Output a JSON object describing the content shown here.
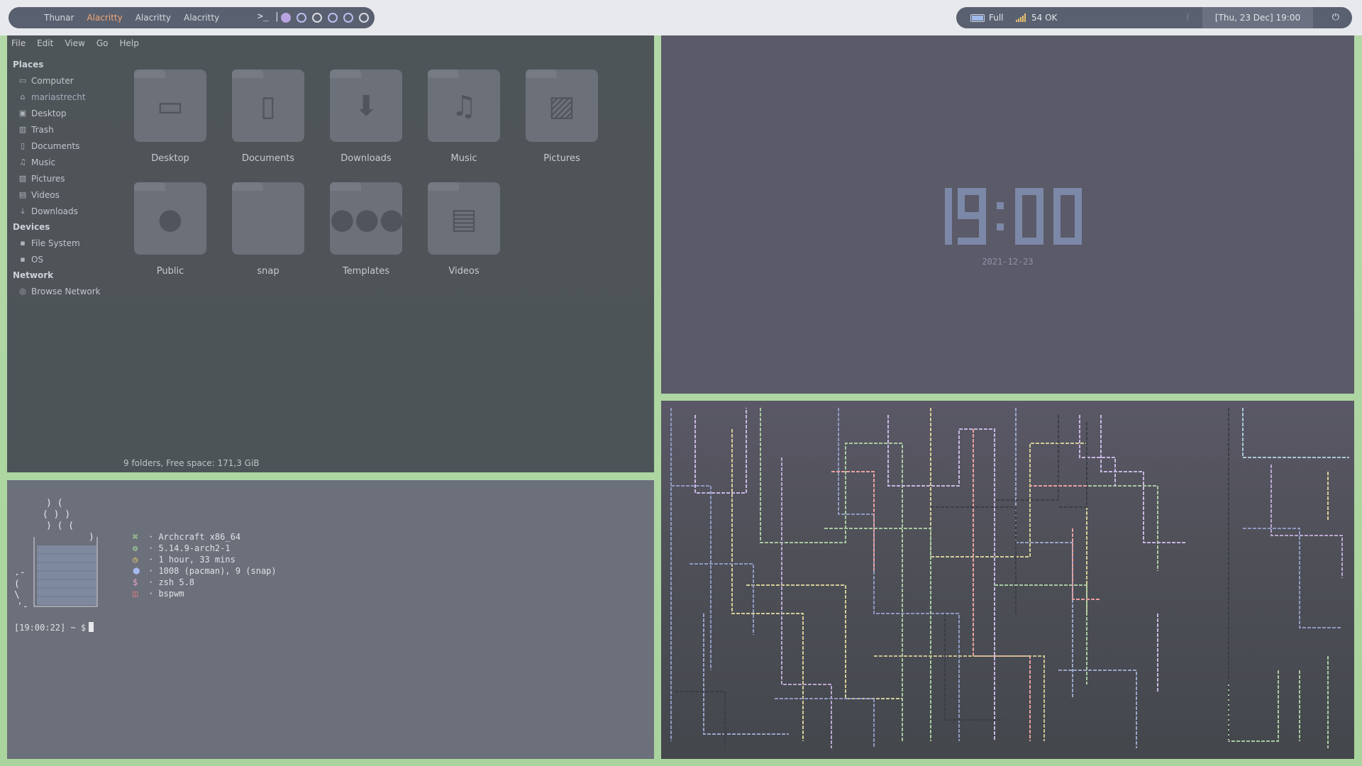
{
  "topbar": {
    "windows": [
      "Thunar",
      "Alacritty",
      "Alacritty",
      "Alacritty"
    ],
    "active_window_index": 1,
    "terminal_glyph": ">_ |",
    "workspaces": [
      "1",
      "2",
      "3",
      "4",
      "5",
      "6"
    ],
    "battery": "Full",
    "network": "54 OK",
    "bluetooth_icon": "bluetooth-icon",
    "datetime": "[Thu, 23 Dec] 19:00",
    "power_icon": "power-icon"
  },
  "thunar": {
    "menu": [
      "File",
      "Edit",
      "View",
      "Go",
      "Help"
    ],
    "sidebar": {
      "places_header": "Places",
      "places": [
        {
          "label": "Computer",
          "icon": "computer-icon"
        },
        {
          "label": "mariastrecht",
          "icon": "home-icon"
        },
        {
          "label": "Desktop",
          "icon": "desktop-icon"
        },
        {
          "label": "Trash",
          "icon": "trash-icon"
        },
        {
          "label": "Documents",
          "icon": "document-icon"
        },
        {
          "label": "Music",
          "icon": "music-icon"
        },
        {
          "label": "Pictures",
          "icon": "picture-icon"
        },
        {
          "label": "Videos",
          "icon": "video-icon"
        },
        {
          "label": "Downloads",
          "icon": "download-icon"
        }
      ],
      "devices_header": "Devices",
      "devices": [
        {
          "label": "File System",
          "icon": "drive-icon"
        },
        {
          "label": "OS",
          "icon": "drive-icon"
        }
      ],
      "network_header": "Network",
      "network": [
        {
          "label": "Browse Network",
          "icon": "network-icon"
        }
      ]
    },
    "folders": [
      {
        "label": "Desktop",
        "icon": "desktop-icon"
      },
      {
        "label": "Documents",
        "icon": "document-icon"
      },
      {
        "label": "Downloads",
        "icon": "download-icon"
      },
      {
        "label": "Music",
        "icon": "music-icon"
      },
      {
        "label": "Pictures",
        "icon": "picture-icon"
      },
      {
        "label": "Public",
        "icon": "person-icon"
      },
      {
        "label": "snap",
        "icon": "folder-icon"
      },
      {
        "label": "Templates",
        "icon": "templates-icon"
      },
      {
        "label": "Videos",
        "icon": "video-icon"
      }
    ],
    "status": "9 folders, Free space: 171,3 GiB"
  },
  "clock": {
    "time": "19:00",
    "date": "2021-12-23"
  },
  "terminal": {
    "info": [
      {
        "icon": "⌘",
        "color": "#a8e0a0",
        "text": "· Archcraft x86_64"
      },
      {
        "icon": "⚙",
        "color": "#a8e0a0",
        "text": "· 5.14.9-arch2-1"
      },
      {
        "icon": "◷",
        "color": "#f0d070",
        "text": "· 1 hour, 33 mins"
      },
      {
        "icon": "⬢",
        "color": "#a8b8f0",
        "text": "· 1008 (pacman), 9 (snap)"
      },
      {
        "icon": "$",
        "color": "#e8a0c8",
        "text": "· zsh 5.8"
      },
      {
        "icon": "◫",
        "color": "#f08080",
        "text": "· bspwm"
      }
    ],
    "prompt": "[19:00:22] ~ $"
  },
  "colors": {
    "accent": "#f0a878",
    "panel": "#596070",
    "desktop_green": "#a9d49d"
  }
}
